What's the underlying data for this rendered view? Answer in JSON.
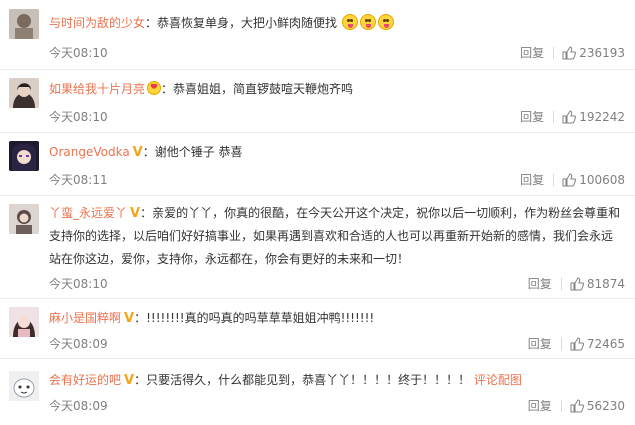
{
  "comments": [
    {
      "user": "与时间为敌的少女",
      "verified": false,
      "text": "：恭喜恢复单身，大把小鲜肉随便找",
      "time": "今天08:10",
      "reply": "回复",
      "likes": "236193",
      "avatar_color": "#7a6a5e"
    },
    {
      "user": "如果给我十片月亮",
      "verified": false,
      "text": "：恭喜姐姐，简直锣鼓喧天鞭炮齐鸣",
      "time": "今天08:10",
      "reply": "回复",
      "likes": "192242",
      "avatar_color": "#3a3030"
    },
    {
      "user": "OrangeVodka",
      "verified": true,
      "text": "：谢他个锤子 恭喜",
      "time": "今天08:11",
      "reply": "回复",
      "likes": "100608",
      "avatar_color": "#2a2238"
    },
    {
      "user": "丫蛮_永远爱丫",
      "verified": true,
      "text": "：亲爱的丫丫，你真的很酷，在今天公开这个决定，祝你以后一切顺利，作为粉丝会尊重和支持你的选择，以后咱们好好搞事业，如果再遇到喜欢和合适的人也可以再重新开始新的感情，我们会永远站在你这边，爱你，支持你，永远都在，你会有更好的未来和一切！",
      "time": "今天08:10",
      "reply": "回复",
      "likes": "81874",
      "avatar_color": "#5a4a48"
    },
    {
      "user": "麻小是国粹啊",
      "verified": true,
      "text": "：!!!!!!!!真的吗真的吗草草草姐姐冲鸭!!!!!!!",
      "time": "今天08:09",
      "reply": "回复",
      "likes": "72465",
      "avatar_color": "#c9a6a0"
    },
    {
      "user": "会有好运的吧",
      "verified": true,
      "text": "：只要活得久，什么都能见到，恭喜丫丫！！！！终于！！！！",
      "link": "评论配图",
      "time": "今天08:09",
      "reply": "回复",
      "likes": "56230",
      "avatar_color": "#d8dce0"
    }
  ],
  "colors": {
    "username": "#eb7350",
    "verified_badge": "#f3a41b",
    "meta": "#808080"
  },
  "icons": {
    "like": "thumbs-up-icon",
    "verified": "verified-v-icon",
    "emoji": "tongue-out-emoji-icon"
  }
}
